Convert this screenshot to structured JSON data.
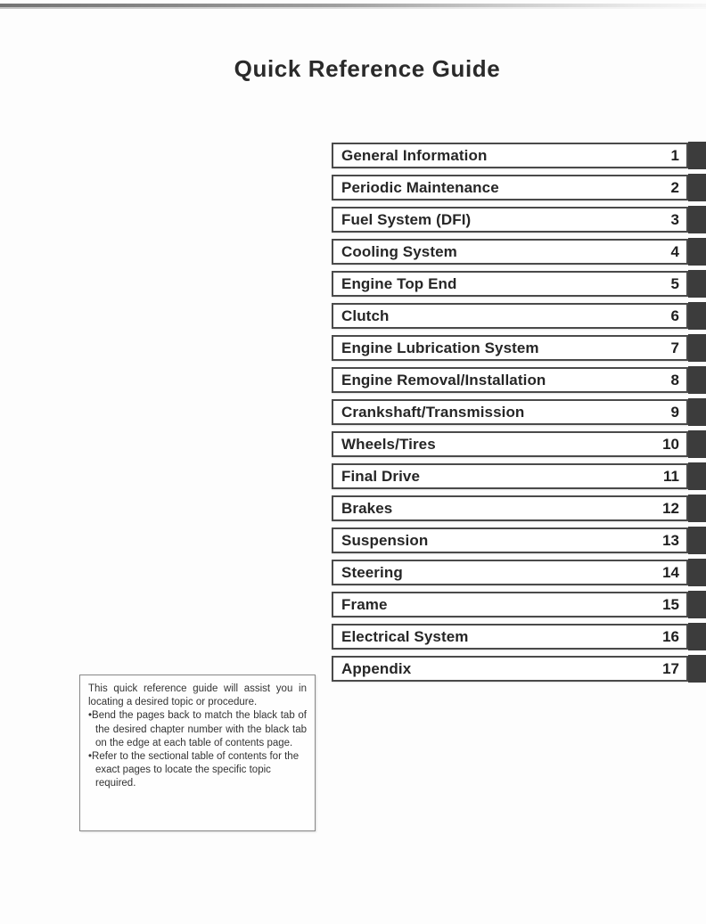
{
  "document": {
    "title": "Quick Reference Guide"
  },
  "chapters": [
    {
      "name": "General Information",
      "number": "1"
    },
    {
      "name": "Periodic Maintenance",
      "number": "2"
    },
    {
      "name": "Fuel System (DFI)",
      "number": "3"
    },
    {
      "name": "Cooling System",
      "number": "4"
    },
    {
      "name": "Engine Top End",
      "number": "5"
    },
    {
      "name": "Clutch",
      "number": "6"
    },
    {
      "name": "Engine Lubrication System",
      "number": "7"
    },
    {
      "name": "Engine Removal/Installation",
      "number": "8"
    },
    {
      "name": "Crankshaft/Transmission",
      "number": "9"
    },
    {
      "name": "Wheels/Tires",
      "number": "10"
    },
    {
      "name": "Final Drive",
      "number": "11"
    },
    {
      "name": "Brakes",
      "number": "12"
    },
    {
      "name": "Suspension",
      "number": "13"
    },
    {
      "name": "Steering",
      "number": "14"
    },
    {
      "name": "Frame",
      "number": "15"
    },
    {
      "name": "Electrical System",
      "number": "16"
    },
    {
      "name": "Appendix",
      "number": "17"
    }
  ],
  "note": {
    "intro": "This quick reference guide will assist you in locating a desired topic or procedure.",
    "bullets": [
      "Bend the pages back to match the black tab of the desired chapter number with the black tab on the edge at each table of contents page.",
      "Refer to the sectional table of contents for the exact pages to locate the specific topic required."
    ],
    "bullet_marker": "•"
  },
  "colors": {
    "tab_black": "#3c3c3c",
    "box_border": "#4a4a4a",
    "text": "#262626",
    "note_border": "#888888"
  }
}
